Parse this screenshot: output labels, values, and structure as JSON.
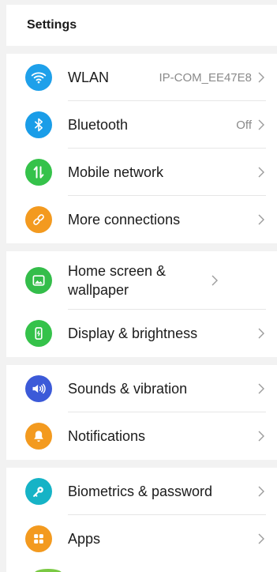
{
  "header": {
    "title": "Settings"
  },
  "colors": {
    "wlan": "#1ea0ea",
    "bluetooth": "#1a9de8",
    "mobile": "#35c24a",
    "more": "#f39a1f",
    "home": "#34bd4a",
    "display": "#35c24a",
    "sounds": "#3c5ad8",
    "notifications": "#f39a1f",
    "biometrics": "#16b3c6",
    "apps": "#f39a1f"
  },
  "groups": [
    {
      "items": [
        {
          "icon": "wifi-icon",
          "label": "WLAN",
          "value": "IP-COM_EE47E8"
        },
        {
          "icon": "bluetooth-icon",
          "label": "Bluetooth",
          "value": "Off"
        },
        {
          "icon": "mobile-network-icon",
          "label": "Mobile network",
          "value": ""
        },
        {
          "icon": "link-icon",
          "label": "More connections",
          "value": ""
        }
      ]
    },
    {
      "items": [
        {
          "icon": "image-icon",
          "label": "Home screen & wallpaper",
          "value": ""
        },
        {
          "icon": "brightness-icon",
          "label": "Display & brightness",
          "value": ""
        }
      ]
    },
    {
      "items": [
        {
          "icon": "speaker-icon",
          "label": "Sounds & vibration",
          "value": ""
        },
        {
          "icon": "bell-icon",
          "label": "Notifications",
          "value": ""
        }
      ]
    },
    {
      "items": [
        {
          "icon": "key-icon",
          "label": "Biometrics & password",
          "value": ""
        },
        {
          "icon": "apps-grid-icon",
          "label": "Apps",
          "value": ""
        }
      ]
    }
  ]
}
